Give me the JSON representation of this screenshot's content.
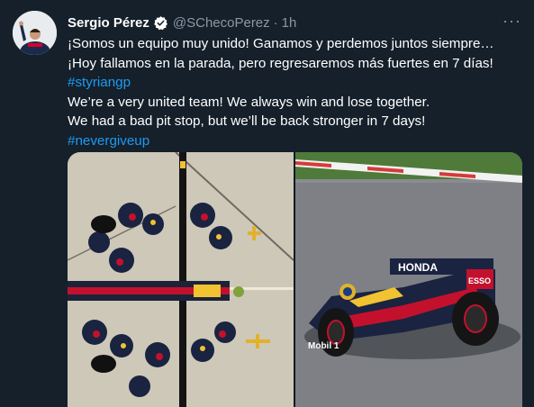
{
  "tweet": {
    "author_name": "Sergio Pérez",
    "handle": "@SChecoPerez",
    "separator": "·",
    "time": "1h",
    "more_label": "···",
    "lines": [
      "¡Somos un equipo muy unido! Ganamos y perdemos juntos siempre…",
      "¡Hoy fallamos en la parada, pero regresaremos más fuertes en 7 días!"
    ],
    "hashtag1": "#styriangp",
    "lines_en": [
      "We’re a very united team! We always win and lose together.",
      "We had a bad pit stop, but we’ll be back stronger in 7 days!"
    ],
    "hashtag2": "#nevergiveup",
    "car_text_honda": "HONDA",
    "car_text_esso": "ESSO",
    "car_text_mobil": "Mobil 1"
  },
  "icons": {
    "verified": "verified-badge-icon",
    "more": "more-options-icon"
  },
  "colors": {
    "background": "#15202b",
    "link": "#1d9bf0",
    "muted": "#8b98a5",
    "verified": "#1d9bf0"
  }
}
